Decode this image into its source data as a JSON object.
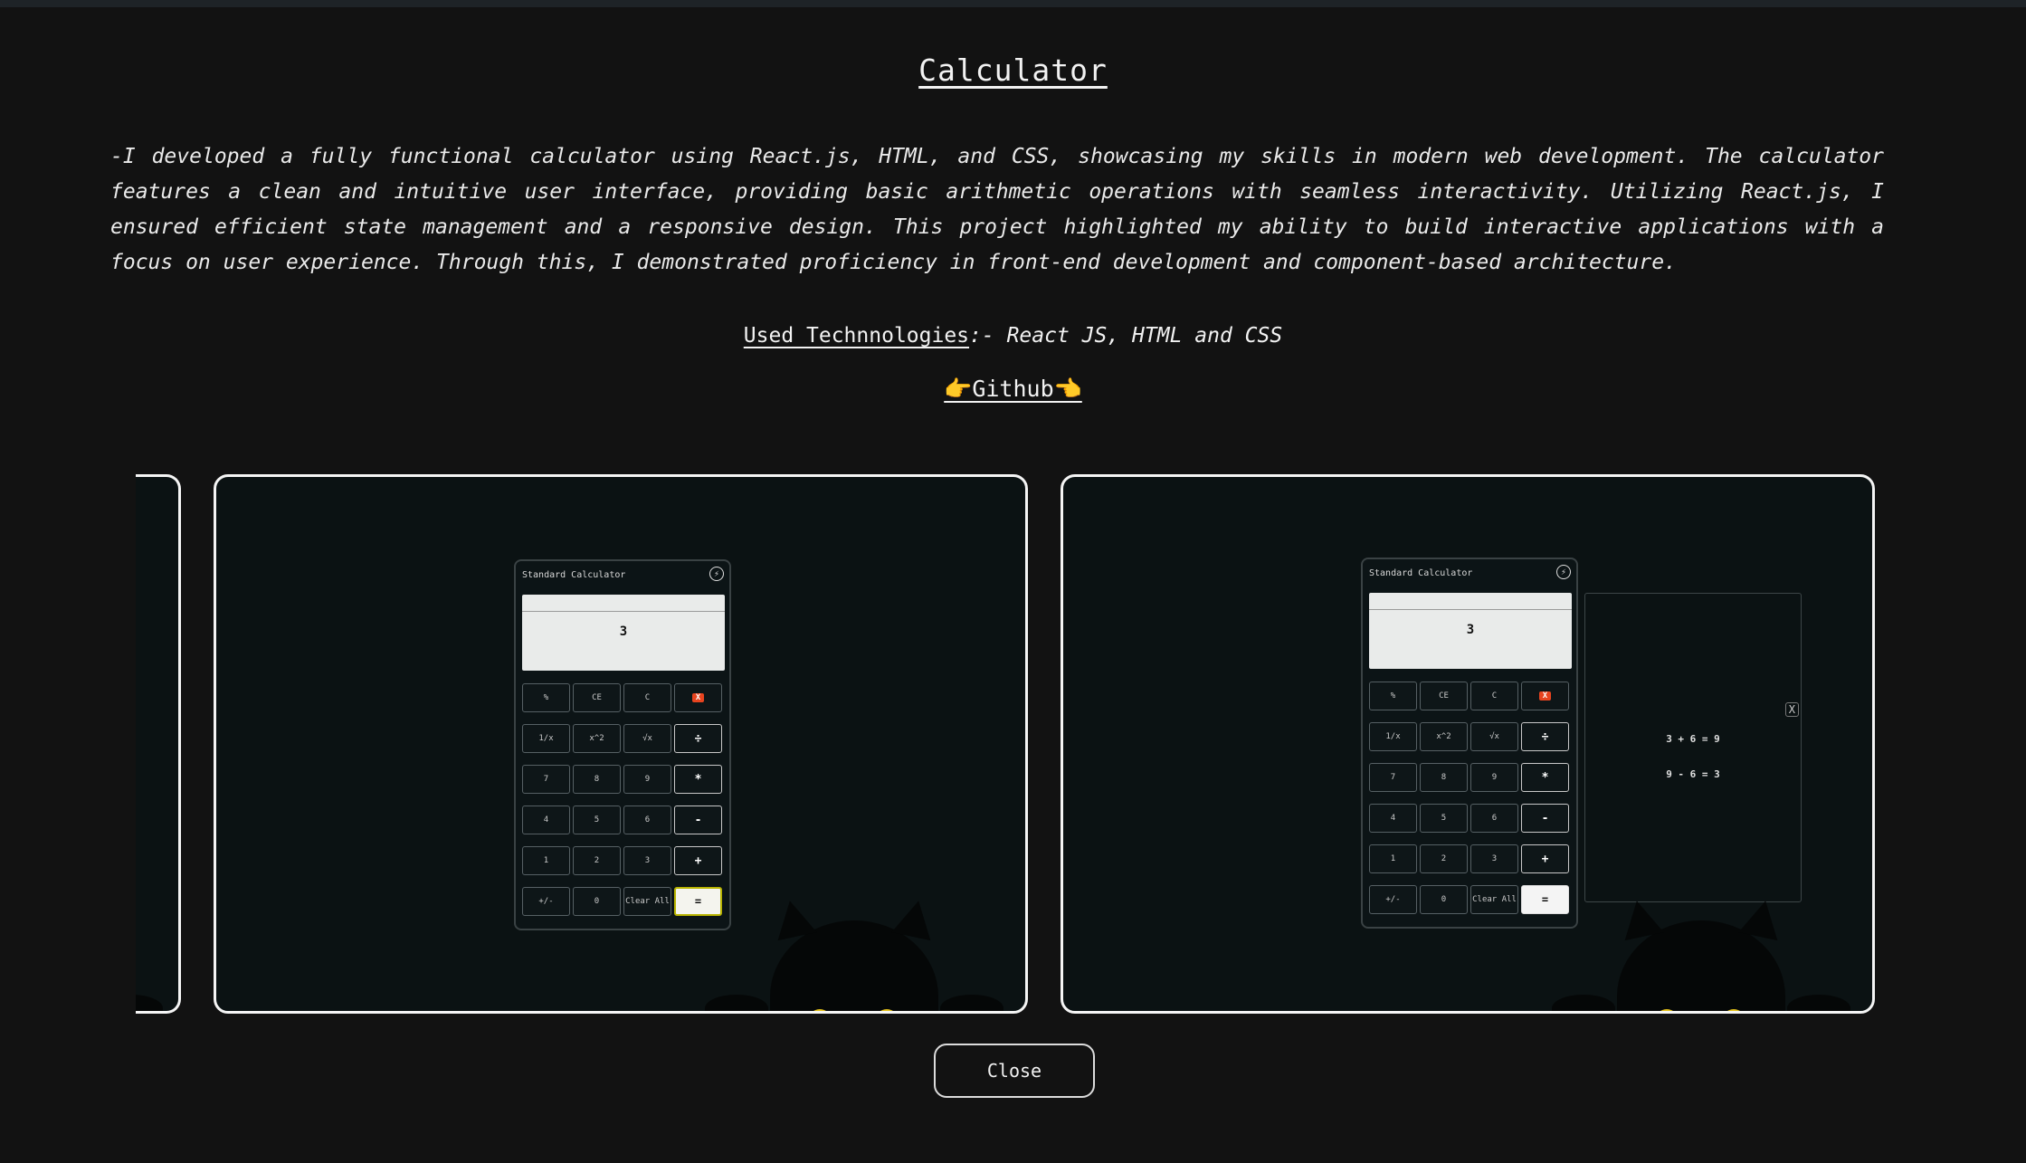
{
  "project": {
    "title": "Calculator",
    "description": "-I developed a fully functional calculator using React.js, HTML, and CSS, showcasing my skills in modern web development. The calculator features a clean and intuitive user interface, providing basic arithmetic operations with seamless interactivity. Utilizing React.js, I ensured efficient state management and a responsive design. This project highlighted my ability to build interactive applications with a focus on user experience. Through this, I demonstrated proficiency in front-end development and component-based architecture.",
    "tech_label": "Used Technnologies",
    "tech_sep": ":- ",
    "tech_list": "React JS, HTML and CSS",
    "github_label": "👉Github👈"
  },
  "calculator": {
    "title": "Standard Calculator",
    "display_value": "3",
    "keys": [
      "%",
      "CE",
      "C",
      "X",
      "1/x",
      "x^2",
      "√x",
      "÷",
      "7",
      "8",
      "9",
      "*",
      "4",
      "5",
      "6",
      "-",
      "1",
      "2",
      "3",
      "+",
      "+/-",
      "0",
      "Clear All",
      "="
    ]
  },
  "history": {
    "close_label": "X",
    "entries": [
      "3 + 6 = 9",
      "9 - 6 = 3"
    ]
  },
  "close_button": "Close"
}
